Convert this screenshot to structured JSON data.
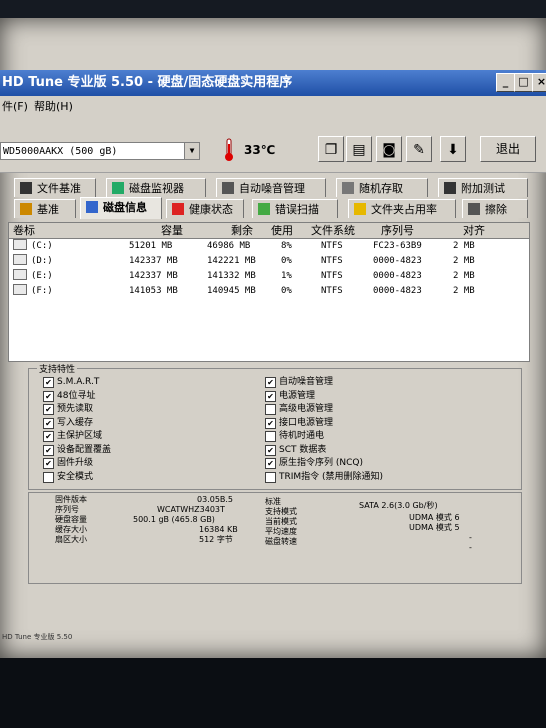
{
  "window": {
    "title": "HD Tune 专业版 5.50 - 硬盘/固态硬盘实用程序",
    "minimize": "_",
    "maximize": "□",
    "close": "×"
  },
  "menu": {
    "items": [
      "件(F)",
      "帮助(H)"
    ]
  },
  "toolbar": {
    "drive": "WD5000AAKX (500 gB)",
    "temperature": "33℃",
    "exit_label": "退出",
    "buttons": [
      "copy-icon",
      "copy2-icon",
      "camera-icon",
      "tools-icon",
      "download-icon"
    ]
  },
  "tabs_top": [
    "文件基准",
    "磁盘监视器",
    "自动噪音管理",
    "随机存取",
    "附加测试"
  ],
  "tabs_bottom": [
    "基准",
    "磁盘信息",
    "健康状态",
    "错误扫描",
    "文件夹占用率",
    "擦除"
  ],
  "active_tab": "磁盘信息",
  "list": {
    "headers": [
      "卷标",
      "容量",
      "剩余",
      "使用",
      "文件系统",
      "序列号",
      "对齐"
    ],
    "rows": [
      [
        "(C:)",
        "51201 MB",
        "46986 MB",
        "8%",
        "NTFS",
        "FC23-63B9",
        "2 MB"
      ],
      [
        "(D:)",
        "142337 MB",
        "142221 MB",
        "0%",
        "NTFS",
        "0000-4823",
        "2 MB"
      ],
      [
        "(E:)",
        "142337 MB",
        "141332 MB",
        "1%",
        "NTFS",
        "0000-4823",
        "2 MB"
      ],
      [
        "(F:)",
        "141053 MB",
        "140945 MB",
        "0%",
        "NTFS",
        "0000-4823",
        "2 MB"
      ]
    ]
  },
  "features": {
    "title": "支持特性",
    "left": [
      {
        "label": "S.M.A.R.T",
        "checked": true
      },
      {
        "label": "48位寻址",
        "checked": true
      },
      {
        "label": "预先读取",
        "checked": true
      },
      {
        "label": "写入缓存",
        "checked": true
      },
      {
        "label": "主保护区域",
        "checked": true
      },
      {
        "label": "设备配置覆盖",
        "checked": true
      },
      {
        "label": "固件升级",
        "checked": true
      },
      {
        "label": "安全模式",
        "checked": false
      }
    ],
    "right": [
      {
        "label": "自动噪音管理",
        "checked": true
      },
      {
        "label": "电源管理",
        "checked": true
      },
      {
        "label": "高级电源管理",
        "checked": false
      },
      {
        "label": "接口电源管理",
        "checked": true
      },
      {
        "label": "待机时通电",
        "checked": false
      },
      {
        "label": "SCT 数据表",
        "checked": true
      },
      {
        "label": "原生指令序列 (NCQ)",
        "checked": true
      },
      {
        "label": "TRIM指令 (禁用删除通知)",
        "checked": false
      }
    ]
  },
  "info": {
    "left_labels": [
      "固件版本",
      "序列号",
      "硬盘容量",
      "缓存大小",
      "扇区大小"
    ],
    "left_values": [
      "03.05B.5",
      "WCATWHZ3403T",
      "500.1 gB (465.8 GB)",
      "16384 KB",
      "512 字节"
    ],
    "right_labels": [
      "标准",
      "支持模式",
      "当前模式",
      "平均速度",
      "磁盘转速"
    ],
    "right_values": [
      "SATA 2.6(3.0 Gb/秒)",
      "UDMA 模式 6",
      "UDMA 模式 5",
      "-",
      "-"
    ]
  },
  "statusbar": "HD Tune 专业版 5.50"
}
